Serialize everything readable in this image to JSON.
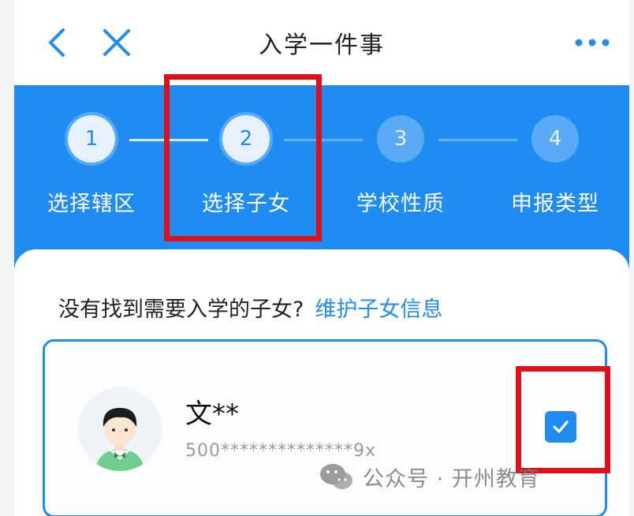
{
  "header": {
    "title": "入学一件事",
    "back_icon": "chevron-left-icon",
    "close_icon": "close-icon",
    "more_icon": "more-dots-icon"
  },
  "steps": [
    {
      "number": "1",
      "label": "选择辖区",
      "state": "done"
    },
    {
      "number": "2",
      "label": "选择子女",
      "state": "current"
    },
    {
      "number": "3",
      "label": "学校性质",
      "state": "todo"
    },
    {
      "number": "4",
      "label": "申报类型",
      "state": "todo"
    }
  ],
  "children_section": {
    "prompt": "没有找到需要入学的子女?",
    "link": "维护子女信息"
  },
  "child": {
    "name": "文**",
    "id_number": "500**************9x",
    "selected": true,
    "avatar_icon": "child-avatar-icon",
    "check_icon": "checkmark-icon"
  },
  "watermark": {
    "text": "公众号 · 开州教育",
    "icon": "wechat-icon"
  },
  "colors": {
    "primary": "#1e8cf1",
    "highlight": "#e0101a"
  }
}
